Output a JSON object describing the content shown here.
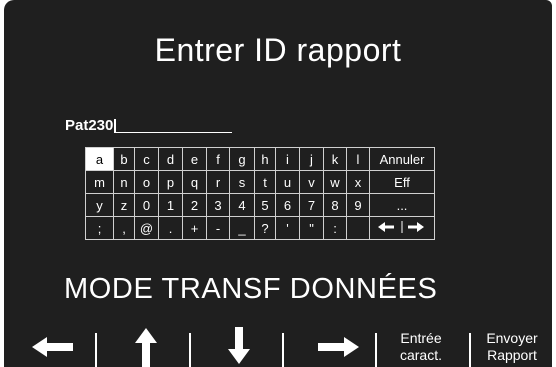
{
  "title": "Entrer ID rapport",
  "entry": {
    "value": "Pat230"
  },
  "keyboard": {
    "rows": [
      [
        "a",
        "b",
        "c",
        "d",
        "e",
        "f",
        "g",
        "h",
        "i",
        "j",
        "k",
        "l",
        "Annuler"
      ],
      [
        "m",
        "n",
        "o",
        "p",
        "q",
        "r",
        "s",
        "t",
        "u",
        "v",
        "w",
        "x",
        "Eff"
      ],
      [
        "y",
        "z",
        "0",
        "1",
        "2",
        "3",
        "4",
        "5",
        "6",
        "7",
        "8",
        "9",
        "..."
      ],
      [
        ";",
        ",",
        "@",
        ".",
        "+",
        "-",
        "_",
        "?",
        "'",
        "\"",
        ":",
        "",
        "arrows"
      ]
    ],
    "selected_key": "a"
  },
  "mode_label": "MODE TRANSF DONNÉES",
  "softkeys": {
    "left_icon": "arrow-left-icon",
    "up_icon": "arrow-up-icon",
    "down_icon": "arrow-down-icon",
    "right_icon": "arrow-right-icon",
    "enter_line1": "Entrée",
    "enter_line2": "caract.",
    "send_line1": "Envoyer",
    "send_line2": "Rapport"
  }
}
